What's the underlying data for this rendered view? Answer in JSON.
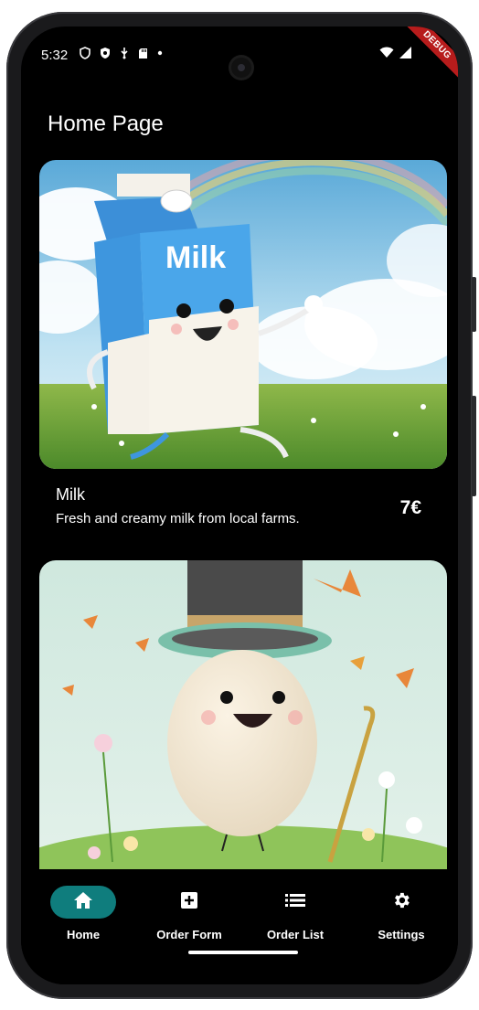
{
  "status_bar": {
    "time": "5:32",
    "left_icons": [
      "shield-outline-icon",
      "shield-filled-icon",
      "usb-icon",
      "sd-card-icon",
      "dot-icon"
    ],
    "right_icons": [
      "wifi-icon",
      "cellular-icon"
    ],
    "debug_banner": "DEBUG"
  },
  "app_bar": {
    "title": "Home Page"
  },
  "products": [
    {
      "name": "Milk",
      "description": "Fresh and creamy milk from local farms.",
      "price": "7€",
      "image": "milk-carton-mascot"
    },
    {
      "name": "",
      "description": "",
      "price": "",
      "image": "egg-mascot-top-hat"
    }
  ],
  "nav": {
    "items": [
      {
        "label": "Home",
        "icon": "home-icon",
        "active": true
      },
      {
        "label": "Order Form",
        "icon": "add-box-icon",
        "active": false
      },
      {
        "label": "Order List",
        "icon": "list-icon",
        "active": false
      },
      {
        "label": "Settings",
        "icon": "gear-icon",
        "active": false
      }
    ]
  },
  "colors": {
    "accent": "#0f7d7d",
    "background": "#000000",
    "text": "#ffffff",
    "debug": "#b71c1c"
  }
}
